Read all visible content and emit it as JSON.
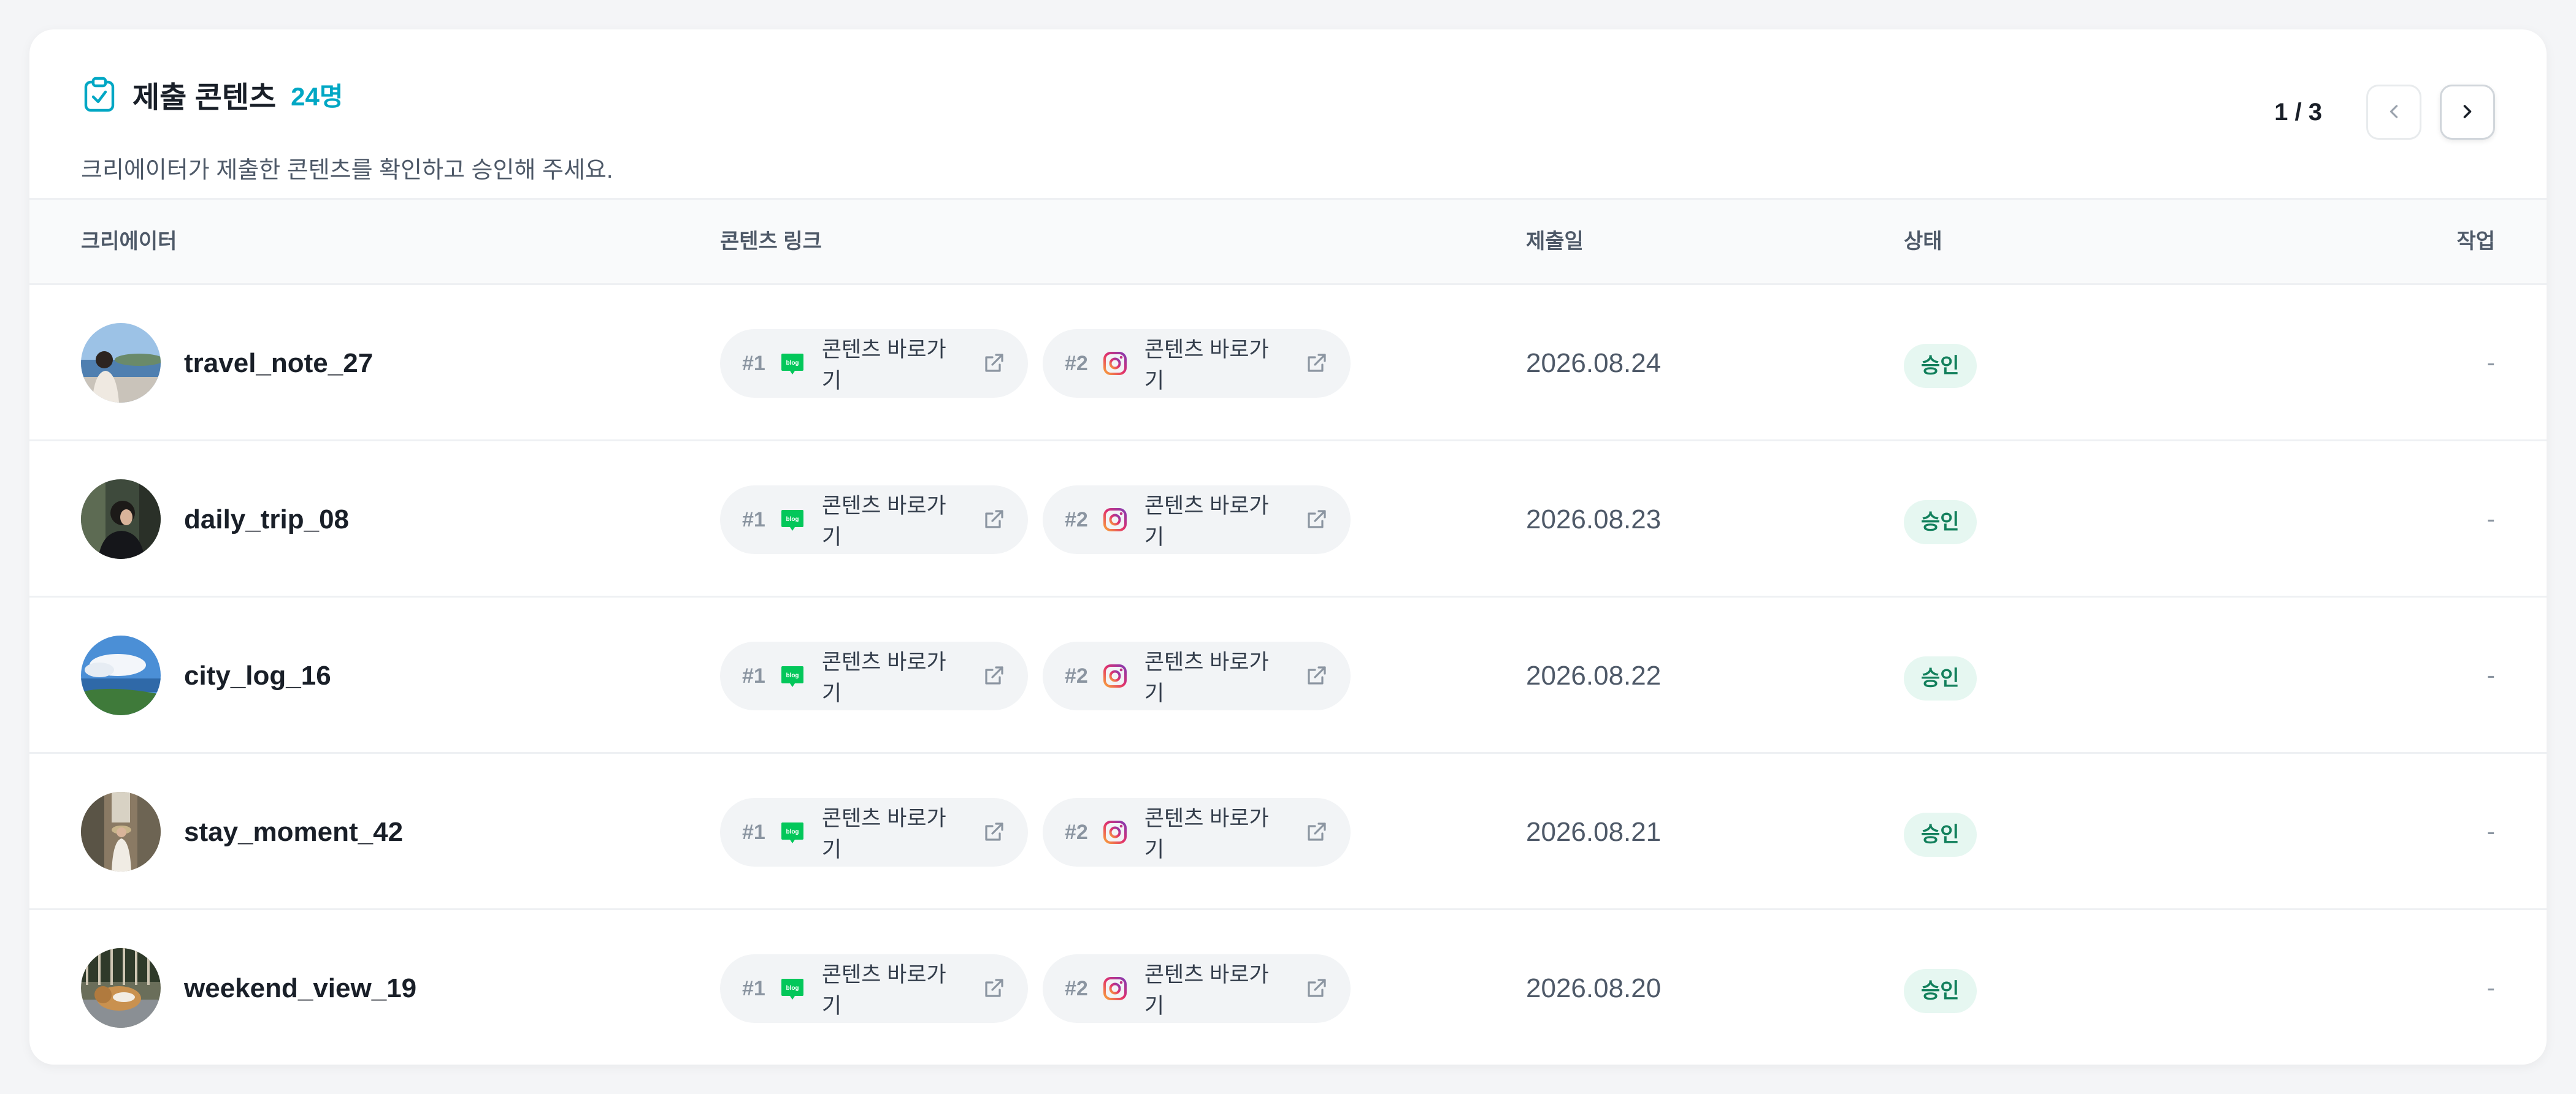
{
  "header": {
    "title": "제출 콘텐츠",
    "count": "24명",
    "subtitle": "크리에이터가 제출한 콘텐츠를 확인하고 승인해 주세요.",
    "pagination": "1 / 3"
  },
  "table": {
    "columns": {
      "creator": "크리에이터",
      "link": "콘텐츠 링크",
      "date": "제출일",
      "status": "상태",
      "action": "작업"
    },
    "rows": [
      {
        "name": "travel_note_27",
        "links": [
          {
            "num": "#1",
            "platform": "blog",
            "label": "콘텐츠 바로가기"
          },
          {
            "num": "#2",
            "platform": "instagram",
            "label": "콘텐츠 바로가기"
          }
        ],
        "date": "2026.08.24",
        "status": "승인",
        "action": "-"
      },
      {
        "name": "daily_trip_08",
        "links": [
          {
            "num": "#1",
            "platform": "blog",
            "label": "콘텐츠 바로가기"
          },
          {
            "num": "#2",
            "platform": "instagram",
            "label": "콘텐츠 바로가기"
          }
        ],
        "date": "2026.08.23",
        "status": "승인",
        "action": "-"
      },
      {
        "name": "city_log_16",
        "links": [
          {
            "num": "#1",
            "platform": "blog",
            "label": "콘텐츠 바로가기"
          },
          {
            "num": "#2",
            "platform": "instagram",
            "label": "콘텐츠 바로가기"
          }
        ],
        "date": "2026.08.22",
        "status": "승인",
        "action": "-"
      },
      {
        "name": "stay_moment_42",
        "links": [
          {
            "num": "#1",
            "platform": "blog",
            "label": "콘텐츠 바로가기"
          },
          {
            "num": "#2",
            "platform": "instagram",
            "label": "콘텐츠 바로가기"
          }
        ],
        "date": "2026.08.21",
        "status": "승인",
        "action": "-"
      },
      {
        "name": "weekend_view_19",
        "links": [
          {
            "num": "#1",
            "platform": "blog",
            "label": "콘텐츠 바로가기"
          },
          {
            "num": "#2",
            "platform": "instagram",
            "label": "콘텐츠 바로가기"
          }
        ],
        "date": "2026.08.20",
        "status": "승인",
        "action": "-"
      }
    ]
  },
  "icons": {
    "title": "clipboard-check-icon",
    "prev": "chevron-left-icon",
    "next": "chevron-right-icon",
    "blog": "naver-blog-icon",
    "instagram": "instagram-icon",
    "external": "external-link-icon"
  },
  "colors": {
    "accent": "#00a7c4",
    "blog_green": "#03c75a",
    "status_bg": "#e6f7f1",
    "status_text": "#12805c"
  }
}
